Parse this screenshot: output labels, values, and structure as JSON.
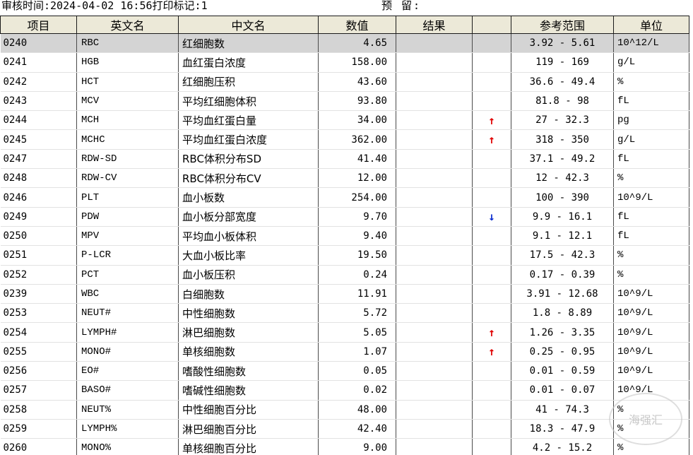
{
  "header": {
    "audit_label": "审核时间:",
    "audit_time": "2024-04-02 16:56",
    "print_label": "打印标记:",
    "print_flag": "1",
    "reserve_label": "预  留:",
    "corner_text": ""
  },
  "columns": [
    "项目",
    "英文名",
    "中文名",
    "数值",
    "结果",
    "",
    "参考范围",
    "单位"
  ],
  "rows": [
    {
      "code": "0240",
      "en": "RBC",
      "cn": "红细胞数",
      "value": "4.65",
      "result": "",
      "flag": "",
      "range": "3.92 - 5.61",
      "unit": "10^12/L"
    },
    {
      "code": "0241",
      "en": "HGB",
      "cn": "血红蛋白浓度",
      "value": "158.00",
      "result": "",
      "flag": "",
      "range": "119 - 169",
      "unit": "g/L"
    },
    {
      "code": "0242",
      "en": "HCT",
      "cn": "红细胞压积",
      "value": "43.60",
      "result": "",
      "flag": "",
      "range": "36.6 - 49.4",
      "unit": "%"
    },
    {
      "code": "0243",
      "en": "MCV",
      "cn": "平均红细胞体积",
      "value": "93.80",
      "result": "",
      "flag": "",
      "range": "81.8 - 98",
      "unit": "fL"
    },
    {
      "code": "0244",
      "en": "MCH",
      "cn": "平均血红蛋白量",
      "value": "34.00",
      "result": "",
      "flag": "↑",
      "range": "27 - 32.3",
      "unit": "pg"
    },
    {
      "code": "0245",
      "en": "MCHC",
      "cn": "平均血红蛋白浓度",
      "value": "362.00",
      "result": "",
      "flag": "↑",
      "range": "318 - 350",
      "unit": "g/L"
    },
    {
      "code": "0247",
      "en": "RDW-SD",
      "cn": "RBC体积分布SD",
      "value": "41.40",
      "result": "",
      "flag": "",
      "range": "37.1 - 49.2",
      "unit": "fL"
    },
    {
      "code": "0248",
      "en": "RDW-CV",
      "cn": "RBC体积分布CV",
      "value": "12.00",
      "result": "",
      "flag": "",
      "range": "12 - 42.3",
      "unit": "%"
    },
    {
      "code": "0246",
      "en": "PLT",
      "cn": "血小板数",
      "value": "254.00",
      "result": "",
      "flag": "",
      "range": "100 - 390",
      "unit": "10^9/L"
    },
    {
      "code": "0249",
      "en": "PDW",
      "cn": "血小板分部宽度",
      "value": "9.70",
      "result": "",
      "flag": "↓",
      "range": "9.9 - 16.1",
      "unit": "fL"
    },
    {
      "code": "0250",
      "en": "MPV",
      "cn": "平均血小板体积",
      "value": "9.40",
      "result": "",
      "flag": "",
      "range": "9.1 - 12.1",
      "unit": "fL"
    },
    {
      "code": "0251",
      "en": "P-LCR",
      "cn": "大血小板比率",
      "value": "19.50",
      "result": "",
      "flag": "",
      "range": "17.5 - 42.3",
      "unit": "%"
    },
    {
      "code": "0252",
      "en": "PCT",
      "cn": "血小板压积",
      "value": "0.24",
      "result": "",
      "flag": "",
      "range": "0.17 - 0.39",
      "unit": "%"
    },
    {
      "code": "0239",
      "en": "WBC",
      "cn": "白细胞数",
      "value": "11.91",
      "result": "",
      "flag": "",
      "range": "3.91 - 12.68",
      "unit": "10^9/L"
    },
    {
      "code": "0253",
      "en": "NEUT#",
      "cn": "中性细胞数",
      "value": "5.72",
      "result": "",
      "flag": "",
      "range": "1.8 - 8.89",
      "unit": "10^9/L"
    },
    {
      "code": "0254",
      "en": "LYMPH#",
      "cn": "淋巴细胞数",
      "value": "5.05",
      "result": "",
      "flag": "↑",
      "range": "1.26 - 3.35",
      "unit": "10^9/L"
    },
    {
      "code": "0255",
      "en": "MONO#",
      "cn": "单核细胞数",
      "value": "1.07",
      "result": "",
      "flag": "↑",
      "range": "0.25 - 0.95",
      "unit": "10^9/L"
    },
    {
      "code": "0256",
      "en": "EO#",
      "cn": "嗜酸性细胞数",
      "value": "0.05",
      "result": "",
      "flag": "",
      "range": "0.01 - 0.59",
      "unit": "10^9/L"
    },
    {
      "code": "0257",
      "en": "BASO#",
      "cn": "嗜碱性细胞数",
      "value": "0.02",
      "result": "",
      "flag": "",
      "range": "0.01 - 0.07",
      "unit": "10^9/L"
    },
    {
      "code": "0258",
      "en": "NEUT%",
      "cn": "中性细胞百分比",
      "value": "48.00",
      "result": "",
      "flag": "",
      "range": "41 - 74.3",
      "unit": "%"
    },
    {
      "code": "0259",
      "en": "LYMPH%",
      "cn": "淋巴细胞百分比",
      "value": "42.40",
      "result": "",
      "flag": "",
      "range": "18.3 - 47.9",
      "unit": "%"
    },
    {
      "code": "0260",
      "en": "MONO%",
      "cn": "单核细胞百分比",
      "value": "9.00",
      "result": "",
      "flag": "",
      "range": "4.2 - 15.2",
      "unit": "%"
    }
  ],
  "selected_row": 0,
  "colors": {
    "header_bg": "#ece9d8",
    "selected_bg": "#d4d4d4",
    "flag_up": "#e00000",
    "flag_down": "#1030d0"
  },
  "watermark": "海强汇"
}
